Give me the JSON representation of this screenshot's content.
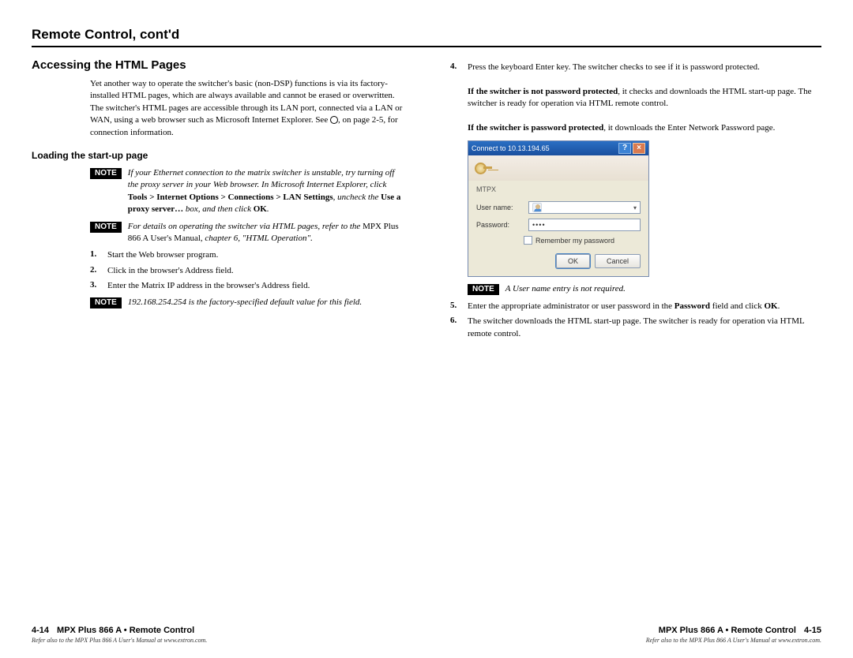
{
  "title": "Remote Control, cont'd",
  "left": {
    "h2": "Accessing the HTML Pages",
    "intro": "Yet another way to operate the switcher's basic (non-DSP) functions is via its factory-installed HTML pages, which are always available and cannot be erased or overwritten. The switcher's HTML pages are accessible through its LAN port, connected via a LAN or WAN, using a web browser such as Microsoft Internet Explorer. See ",
    "intro_tail": ", on page 2-5, for connection information.",
    "h3": "Loading the start-up page",
    "note1_a": "If your Ethernet connection to the matrix switcher is unstable, try turning off the proxy server in your Web browser. In Microsoft Internet Explorer, click ",
    "note1_tools": "Tools > Internet Options > Connections > LAN Settings",
    "note1_b": ", uncheck the ",
    "note1_use_proxy": "Use a proxy server…",
    "note1_c": " box, and then click ",
    "note1_ok": "OK",
    "note1_d": ".",
    "note2_a": "For details on operating the switcher via HTML pages, refer to the ",
    "note2_manual": "MPX Plus 866 A User's Manual",
    "note2_b": ", chapter 6, \"HTML Operation\".",
    "steps": [
      "Start the Web browser program.",
      "Click in the browser's Address field.",
      "Enter the Matrix IP address in the browser's Address field."
    ],
    "note3": "192.168.254.254 is the factory-specified default value for this field."
  },
  "right": {
    "step4_a": "Press the keyboard Enter key. The switcher checks to see if it is password protected.",
    "step4_np_lead": "If the switcher is not password protected",
    "step4_np_body": ", it checks and downloads the HTML start-up page. The switcher is ready for operation via HTML remote control.",
    "step4_pp_lead": "If the switcher is password protected",
    "step4_pp_body": ", it downloads the Enter Network Password page.",
    "dialog": {
      "title": "Connect to 10.13.194.65",
      "host": "MTPX",
      "uname_label": "User name:",
      "pass_label": "Password:",
      "uname_value": "",
      "pass_value": "••••",
      "remember": "Remember my password",
      "ok": "OK",
      "cancel": "Cancel"
    },
    "note4": "A User name entry is not required.",
    "step5_a": "Enter the appropriate administrator or user password in the ",
    "step5_pw": "Password",
    "step5_b": " field and click ",
    "step5_ok": "OK",
    "step5_c": ".",
    "step6": "The switcher downloads the HTML start-up page. The switcher is ready for operation via HTML remote control."
  },
  "note_label": "NOTE",
  "footer": {
    "left_page": "4-14",
    "right_page": "4-15",
    "doctitle": "MPX Plus 866 A • Remote Control",
    "footnote": "Refer also to the MPX Plus 866 A User's Manual at www.extron.com."
  }
}
